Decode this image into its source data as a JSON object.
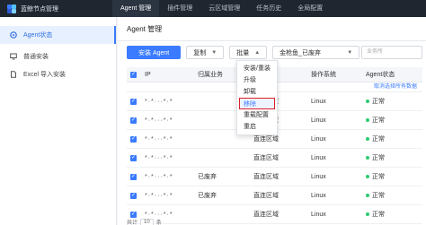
{
  "app": {
    "title": "蓝鲸节点管理",
    "logo_colors": [
      "#3a7bff",
      "#52c1ff",
      "#2d5bd3",
      "#7fd0ff"
    ]
  },
  "nav": [
    {
      "label": "Agent 管理",
      "active": true
    },
    {
      "label": "插件管理",
      "active": false
    },
    {
      "label": "云区域管理",
      "active": false
    },
    {
      "label": "任务历史",
      "active": false
    },
    {
      "label": "全局配置",
      "active": false
    }
  ],
  "sidebar": [
    {
      "label": "Agent状态",
      "icon": "dashboard-icon",
      "active": true
    },
    {
      "label": "普通安装",
      "icon": "monitor-icon",
      "active": false
    },
    {
      "label": "Excel 导入安装",
      "icon": "file-icon",
      "active": false
    }
  ],
  "page_title": "Agent 管理",
  "toolbar": {
    "install": "安装 Agent",
    "copy": "复制",
    "batch": "批量",
    "filter_value": "金枪鱼_已废弃",
    "search_placeholder": "业务所"
  },
  "table": {
    "headers": [
      "IP",
      "归属业务",
      "云区域",
      "操作系统",
      "Agent状态"
    ],
    "hint": "取消选择所有数据",
    "rows": [
      {
        "ip": "*·*···*·*",
        "biz": "",
        "region": "直连区域",
        "os": "Linux",
        "status": "正常"
      },
      {
        "ip": "*·*···*·*",
        "biz": "",
        "region": "直连区域",
        "os": "Linux",
        "status": "正常"
      },
      {
        "ip": "*·*···*·*",
        "biz": "",
        "region": "直连区域",
        "os": "Linux",
        "status": "正常"
      },
      {
        "ip": "*·*···*·*",
        "biz": "",
        "region": "直连区域",
        "os": "Linux",
        "status": "正常"
      },
      {
        "ip": "*·*···*·*",
        "biz": "已废弃",
        "region": "直连区域",
        "os": "Linux",
        "status": "正常"
      },
      {
        "ip": "*·*···*·*",
        "biz": "已废弃",
        "region": "直连区域",
        "os": "Linux",
        "status": "正常"
      },
      {
        "ip": "*·*···*·*",
        "biz": "",
        "region": "直连区域",
        "os": "Linux",
        "status": "正常"
      }
    ]
  },
  "dropdown": {
    "items": [
      "安装/重装",
      "升级",
      "卸载",
      "移除",
      "重载配置",
      "重启"
    ],
    "highlighted": "移除"
  },
  "pager": {
    "prefix": "共计",
    "per_page": "10",
    "suffix": "条"
  }
}
